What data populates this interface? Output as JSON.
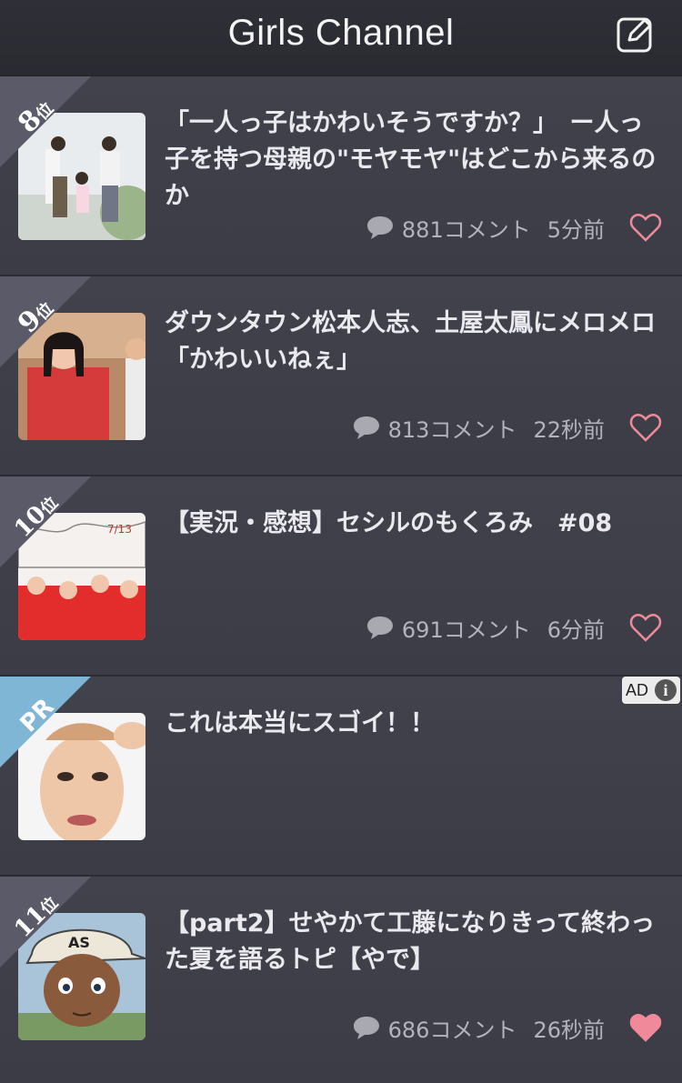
{
  "app": {
    "title": "Girls Channel"
  },
  "topics": [
    {
      "rank": "8",
      "rank_suffix": "位",
      "title": "「一人っ子はかわいそうですか？」　ー人っ子を持つ母親の\"モヤモヤ\"はどこから来るのか",
      "comments": "881コメント",
      "time": "5分前",
      "liked": false
    },
    {
      "rank": "9",
      "rank_suffix": "位",
      "title": "ダウンタウン松本人志、土屋太鳳にメロメロ「かわいいねぇ」",
      "comments": "813コメント",
      "time": "22秒前",
      "liked": false
    },
    {
      "rank": "10",
      "rank_suffix": "位",
      "title": "【実況・感想】セシルのもくろみ　#08",
      "comments": "691コメント",
      "time": "6分前",
      "liked": false
    },
    {
      "rank": "PR",
      "rank_suffix": "",
      "title": "これは本当にスゴイ！！",
      "ad_label": "AD",
      "ad_info": "i"
    },
    {
      "rank": "11",
      "rank_suffix": "位",
      "title": "【part2】せやかて工藤になりきって終わった夏を語るトピ【やで】",
      "comments": "686コメント",
      "time": "26秒前",
      "liked": true
    }
  ],
  "colors": {
    "heart": "#f08a9a",
    "badge": "#5a5a68",
    "pr_badge": "#7fb6d6"
  }
}
